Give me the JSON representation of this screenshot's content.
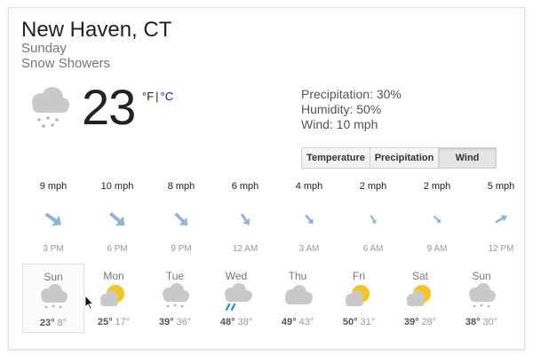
{
  "header": {
    "location": "New Haven, CT",
    "day": "Sunday",
    "condition": "Snow Showers"
  },
  "current": {
    "temperature": "23",
    "unit_f": "°F",
    "separator": "|",
    "unit_c": "°C",
    "icon": "snow-cloud-icon"
  },
  "details": {
    "precipitation": "Precipitation: 30%",
    "humidity": "Humidity: 50%",
    "wind": "Wind: 10 mph"
  },
  "tabs": [
    {
      "label": "Temperature",
      "active": false
    },
    {
      "label": "Precipitation",
      "active": false
    },
    {
      "label": "Wind",
      "active": true
    }
  ],
  "hourly": [
    {
      "speed": "9 mph",
      "time": "3 PM",
      "direction": "wind-arrow-icon"
    },
    {
      "speed": "10 mph",
      "time": "6 PM",
      "direction": "wind-arrow-icon"
    },
    {
      "speed": "8 mph",
      "time": "9 PM",
      "direction": "wind-arrow-icon"
    },
    {
      "speed": "6 mph",
      "time": "12 AM",
      "direction": "wind-arrow-icon"
    },
    {
      "speed": "4 mph",
      "time": "3 AM",
      "direction": "wind-arrow-icon"
    },
    {
      "speed": "2 mph",
      "time": "6 AM",
      "direction": "wind-arrow-icon"
    },
    {
      "speed": "2 mph",
      "time": "9 AM",
      "direction": "wind-arrow-icon"
    },
    {
      "speed": "5 mph",
      "time": "12 PM",
      "direction": "wind-arrow-icon"
    }
  ],
  "daily": [
    {
      "day": "Sun",
      "high": "23°",
      "low": "8°",
      "icon": "snow-cloud-icon",
      "selected": true
    },
    {
      "day": "Mon",
      "high": "25°",
      "low": "17°",
      "icon": "partly-sunny-icon"
    },
    {
      "day": "Tue",
      "high": "39°",
      "low": "36°",
      "icon": "snow-cloud-icon"
    },
    {
      "day": "Wed",
      "high": "48°",
      "low": "38°",
      "icon": "rain-cloud-icon"
    },
    {
      "day": "Thu",
      "high": "49°",
      "low": "43°",
      "icon": "cloudy-icon"
    },
    {
      "day": "Fri",
      "high": "50°",
      "low": "31°",
      "icon": "partly-sunny-icon"
    },
    {
      "day": "Sat",
      "high": "39°",
      "low": "28°",
      "icon": "partly-sunny-icon"
    },
    {
      "day": "Sun",
      "high": "38°",
      "low": "30°",
      "icon": "snow-cloud-icon"
    }
  ],
  "colors": {
    "arrow": "#8fb3da",
    "sun": "#f5c518",
    "cloud": "#c9c9c9",
    "rain": "#3a8fd6",
    "link": "#1a0dab"
  }
}
